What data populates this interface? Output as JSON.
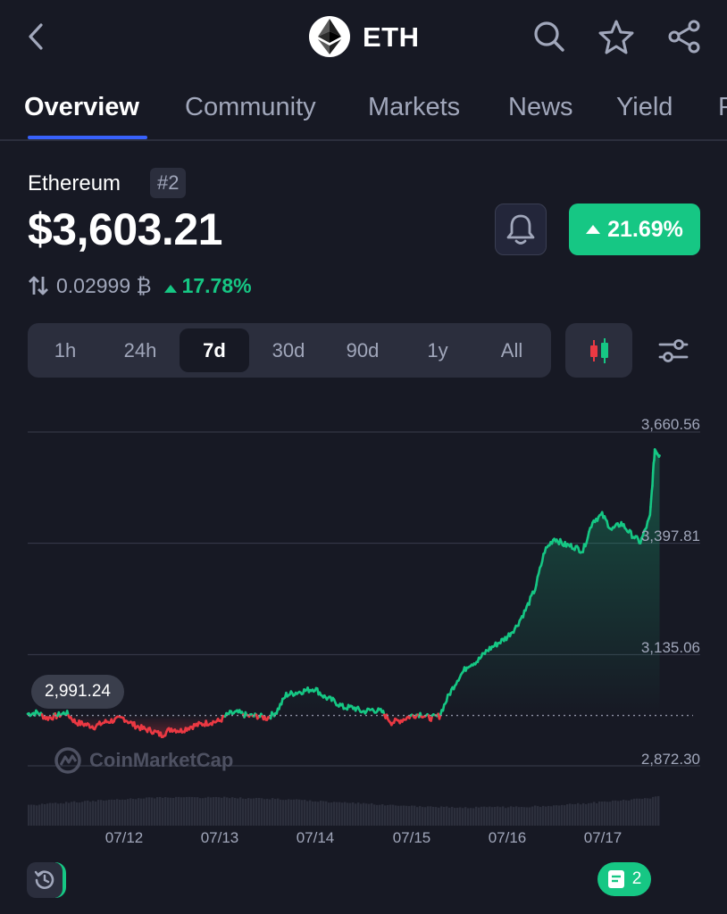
{
  "header": {
    "back_icon": "chevron-left-icon",
    "coin_symbol": "ETH",
    "search_icon": "search-icon",
    "star_icon": "star-icon",
    "share_icon": "share-icon"
  },
  "tabs": [
    {
      "label": "Overview",
      "active": true
    },
    {
      "label": "Community",
      "active": false
    },
    {
      "label": "Markets",
      "active": false
    },
    {
      "label": "News",
      "active": false
    },
    {
      "label": "Yield",
      "active": false
    },
    {
      "label": "P",
      "active": false
    }
  ],
  "coin": {
    "name": "Ethereum",
    "rank": "#2",
    "price": "$3,603.21",
    "change": "21.69%",
    "btc_price": "0.02999 ₿",
    "btc_change": "17.78%"
  },
  "range": {
    "options": [
      "1h",
      "24h",
      "7d",
      "30d",
      "90d",
      "1y",
      "All"
    ],
    "selected": "7d"
  },
  "chart_data": {
    "type": "line",
    "y_ticks": [
      "3,660.56",
      "3,397.81",
      "3,135.06",
      "2,872.30"
    ],
    "ylim": [
      2872.3,
      3660.56
    ],
    "reference_value": 2991.24,
    "reference_label": "2,991.24",
    "x_ticks": [
      "07/12",
      "07/13",
      "07/14",
      "07/15",
      "07/16",
      "07/17"
    ],
    "watermark": "CoinMarketCap",
    "series": [
      {
        "x": [
          0,
          0.1,
          0.2,
          0.3,
          0.4,
          0.5,
          0.6,
          0.7,
          0.8,
          0.9,
          1.0,
          1.1,
          1.2,
          1.3,
          1.4,
          1.5,
          1.6,
          1.7,
          1.8,
          1.9,
          2.0,
          2.1,
          2.2,
          2.3,
          2.4,
          2.5,
          2.6,
          2.7,
          2.8,
          2.9,
          3.0,
          3.1,
          3.2,
          3.3,
          3.4,
          3.5,
          3.6,
          3.7,
          3.8,
          3.9,
          4.0,
          4.1,
          4.2,
          4.3,
          4.4,
          4.5,
          4.6,
          4.7,
          4.8,
          4.9,
          5.0,
          5.1,
          5.2,
          5.3,
          5.4,
          5.5,
          5.6,
          5.7,
          5.8,
          5.9,
          6.0,
          6.1,
          6.2,
          6.3,
          6.4,
          6.5,
          6.55,
          6.6
        ],
        "y": [
          2995,
          2998,
          2985,
          2990,
          2998,
          2975,
          2970,
          2965,
          2975,
          2980,
          2985,
          2970,
          2960,
          2955,
          2945,
          2960,
          2955,
          2965,
          2970,
          2975,
          2978,
          2995,
          2998,
          2990,
          2990,
          2985,
          3000,
          3040,
          3045,
          3050,
          3055,
          3035,
          3025,
          3010,
          3010,
          3000,
          3005,
          3000,
          2975,
          2980,
          2990,
          2995,
          2985,
          2990,
          3040,
          3080,
          3110,
          3120,
          3145,
          3160,
          3175,
          3200,
          3240,
          3290,
          3380,
          3410,
          3395,
          3390,
          3380,
          3450,
          3465,
          3430,
          3445,
          3420,
          3400,
          3460,
          3620,
          3605
        ]
      }
    ]
  },
  "bottom": {
    "history_icon": "history-icon",
    "notes_icon": "note-icon",
    "notes_count": "2"
  },
  "colors": {
    "background": "#171924",
    "accent": "#3861fb",
    "up": "#16c784",
    "down": "#ea3943",
    "muted": "#a1a7bb"
  }
}
